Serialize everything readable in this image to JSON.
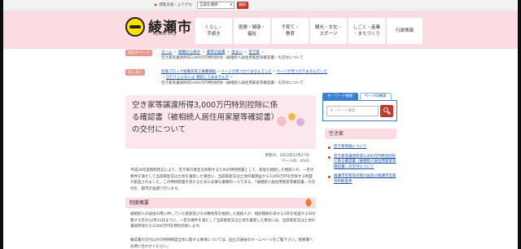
{
  "utility": {
    "link": "閲覧支援・ふりがな",
    "lang_select": "言語を選択",
    "lang_button": "翻訳"
  },
  "header": {
    "logo_text": "綾瀬市",
    "logo_sub": "Ayase City",
    "nav": [
      "くらし・\n手続き",
      "医療・健康・\n福祉",
      "子育て・\n教育",
      "観光・文化・\nスポーツ",
      "しごと・産業\n・まちづくり",
      "行政情報"
    ]
  },
  "breadcrumb": {
    "label": "現在のページ",
    "items": [
      "ホーム",
      "組織から探す",
      "都市計画課",
      "住まい",
      "空き家"
    ],
    "current": "空き家等譲渡所得3,000万円特別控除（被相続人居住用家屋等確認書）の交付について"
  },
  "history": {
    "label": "あしあと",
    "items": [
      "危険ブロック塀撤去等工事費補助",
      "ページが見つかりませんでした",
      "ページが見つかりませんでした",
      "ひとりじゃないよ 相談してみませんか",
      "空き家等譲渡所得3,000万円特別控除（被相続人居住用家屋等確認書）の交付について"
    ]
  },
  "article": {
    "title": "空き家等譲渡所得3,000万円特別控除に係る確認書（被相続人居住用家屋等確認書）の交付について",
    "updated": "更新日：2023年12月27日",
    "page_id": "ページID：4343",
    "intro": "平成28年度税制改正により、空き家の発生を抑制するための特例措置として、家屋を相続した相続人が、一定の要件を満たして当該家屋又は土地を譲渡した場合に、当該家屋又は土地の譲渡益から3,000万円を控除する制度が創設されました。この特例措置を受けるために必要な書類の一つである、「被相続人居住用家屋等確認書」の交付を、都市計画課で行います。",
    "section_heading": "制度概要",
    "section_text": "被相続人の居住の用に供していた家屋及びその敷地等を相続した相続人が、相続開始の日から3年を経過する日の属する年の12月31日までに、一定の要件を満たして当該家屋又は土地を譲渡した場合には、当該家屋又は土地の譲渡所得から3,000万円を特別控除します。",
    "section_text2": "確認書の交付以外の特例制度全体に関する事項については、国土交通省のホームページをご覧下さい。税務署へお問い合わせください。"
  },
  "sidebar": {
    "tab_keyword": "キーワード検索",
    "tab_page_id": "ページID検索",
    "search_placeholder": "キーワード検索",
    "related_heading": "空き家",
    "related_links": [
      "空き家情報について",
      "空き家等譲渡所得3,000万円特別控除に係る確認書（被相続人居住用家屋等確認書）の交付について",
      "綾瀬市空家等対策計画及び綾瀬市空家等判断基準"
    ]
  },
  "colors": {
    "header_pink": "#fbdce2",
    "accent_red": "#c0392b",
    "link_blue": "#1a4fa0"
  }
}
